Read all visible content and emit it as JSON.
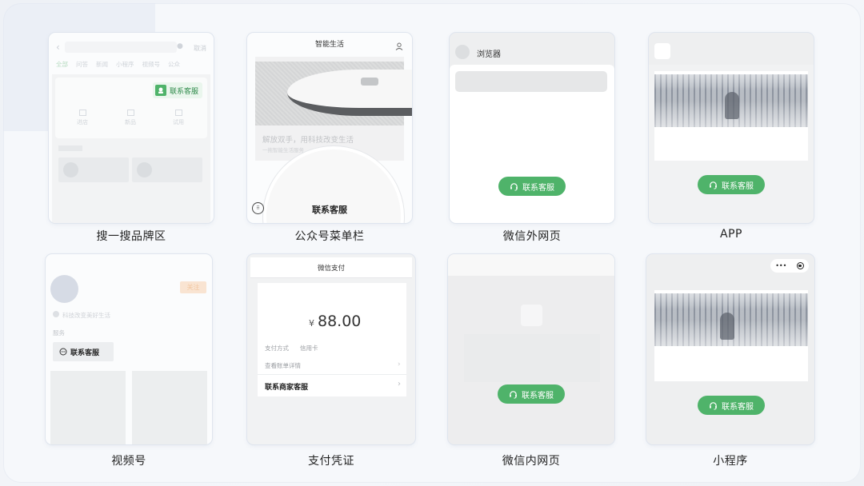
{
  "colors": {
    "accent_green": "#4fb36a",
    "card_border": "#dfe5ee",
    "follow_badge": "#f7dcc3"
  },
  "cards": {
    "search": {
      "caption": "搜一搜品牌区",
      "cancel": "取消",
      "tabs": [
        "全部",
        "问答",
        "新闻",
        "小程序",
        "视频号",
        "公众"
      ],
      "service_btn": "联系客服",
      "icons": [
        "进店",
        "新品",
        "试用"
      ]
    },
    "official": {
      "caption": "公众号菜单栏",
      "title": "智能生活",
      "headline": "解放双手，用科技改变生活",
      "sub": "一拖智能生活服务",
      "menu_label": "联系客服"
    },
    "browser": {
      "caption": "微信外网页",
      "title": "浏览器",
      "service_btn": "联系客服"
    },
    "app": {
      "caption": "APP",
      "service_btn": "联系客服"
    },
    "channels": {
      "caption": "视频号",
      "follow": "关注",
      "desc": "科技改变美好生活",
      "services_label": "服务",
      "service_btn": "联系客服"
    },
    "payment": {
      "caption": "支付凭证",
      "title": "微信支付",
      "currency": "¥",
      "amount": "88.00",
      "pay_method_label": "支付方式",
      "pay_method_value": "信用卡",
      "bill_detail": "查看账单详情",
      "contact_merchant": "联系商家客服"
    },
    "inweb": {
      "caption": "微信内网页",
      "service_btn": "联系客服"
    },
    "miniprogram": {
      "caption": "小程序",
      "more_icon": "•••",
      "service_btn": "联系客服"
    }
  }
}
